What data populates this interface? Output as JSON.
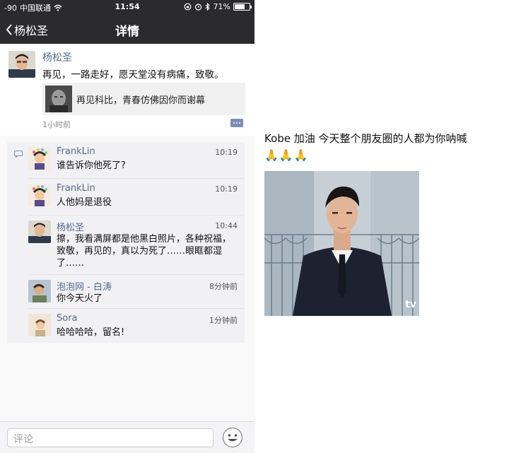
{
  "status_bar": {
    "signal": "-90",
    "carrier": "中国联通",
    "time": "11:54",
    "battery_percent": "71%",
    "battery_level": 0.71
  },
  "nav": {
    "back_label": "杨松圣",
    "title": "详情"
  },
  "post": {
    "author": "杨松圣",
    "text": "再见，一路走好，愿天堂没有病痛，致敬。",
    "shared_text": "再见科比，青春仿佛因你而谢幕",
    "time": "1小时前"
  },
  "comments": [
    {
      "name": "FrankLin",
      "time": "10:19",
      "text": "谁告诉你他死了?"
    },
    {
      "name": "FrankLin",
      "time": "10:19",
      "text": "人他妈是退役"
    },
    {
      "name": "杨松圣",
      "time": "10:44",
      "text": "擦，我看满屏都是他黑白照片，各种祝福，致敬，再见的，真以为死了……眼眶都湿了……"
    },
    {
      "name": "泡泡网 - 白涛",
      "time": "8分钟前",
      "text": "你今天火了"
    },
    {
      "name": "Sora",
      "time": "1分钟前",
      "text": "哈哈哈哈，留名!"
    }
  ],
  "input": {
    "placeholder": "评论"
  },
  "right_panel": {
    "caption": "Kobe 加油 今天整个朋友圈的人都为你呐喊",
    "emoji": "🙏🙏🙏",
    "watermark": "tv"
  },
  "colors": {
    "nav_bg": "#2b2b2d",
    "name_link": "#56698f",
    "comment_bg": "#f1f1f3"
  }
}
